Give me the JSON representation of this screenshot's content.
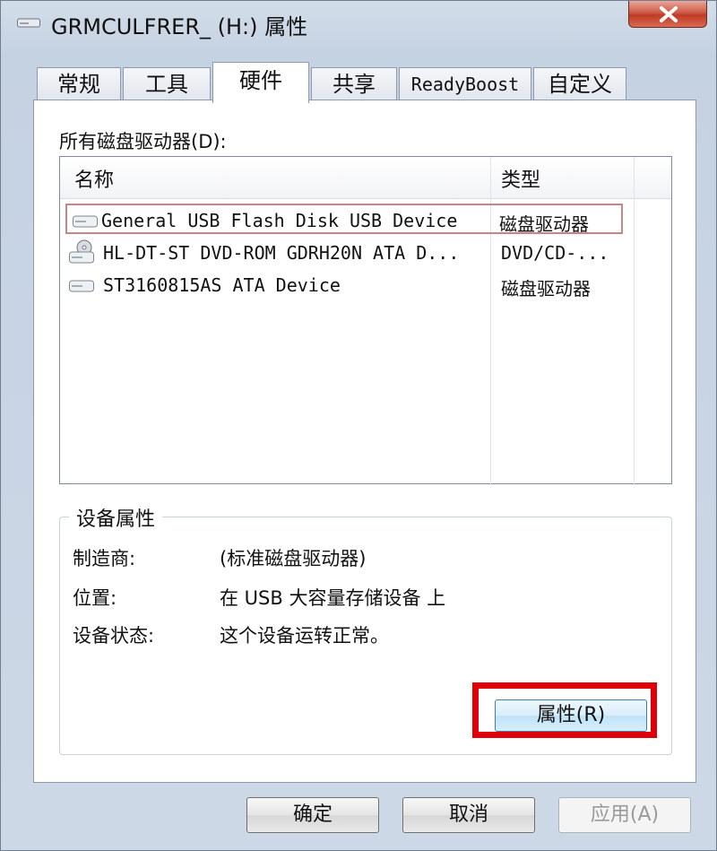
{
  "window": {
    "title": "GRMCULFRER_ (H:) 属性",
    "icon": "drive-icon",
    "close_icon": "close-icon"
  },
  "tabs": [
    {
      "label": "常规"
    },
    {
      "label": "工具"
    },
    {
      "label": "硬件",
      "active": true
    },
    {
      "label": "共享"
    },
    {
      "label": "ReadyBoost"
    },
    {
      "label": "自定义"
    }
  ],
  "hardware": {
    "list_label": "所有磁盘驱动器(D):",
    "columns": {
      "name": "名称",
      "type": "类型"
    },
    "devices": [
      {
        "name": "General USB Flash Disk USB Device",
        "type": "磁盘驱动器",
        "icon": "disk-drive-icon",
        "selected": true
      },
      {
        "name": "HL-DT-ST DVD-ROM GDRH20N ATA D...",
        "type": "DVD/CD-...",
        "icon": "optical-drive-icon"
      },
      {
        "name": "ST3160815AS ATA Device",
        "type": "磁盘驱动器",
        "icon": "disk-drive-icon"
      }
    ]
  },
  "device_properties": {
    "legend": "设备属性",
    "manufacturer_label": "制造商:",
    "manufacturer_value": "(标准磁盘驱动器)",
    "location_label": "位置:",
    "location_value": "在 USB 大容量存储设备 上",
    "status_label": "设备状态:",
    "status_value": "这个设备运转正常。",
    "properties_button": "属性(R)",
    "highlight_color": "#e0000a"
  },
  "buttons": {
    "ok": "确定",
    "cancel": "取消",
    "apply": "应用(A)"
  }
}
